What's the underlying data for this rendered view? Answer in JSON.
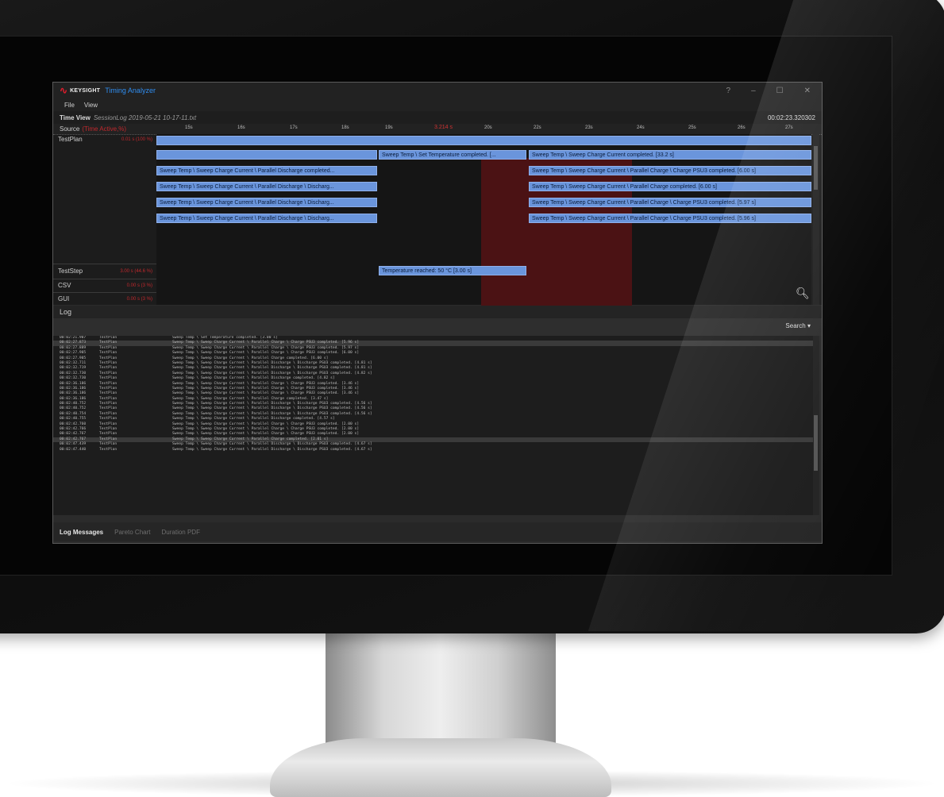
{
  "app": {
    "brand": "KEYSIGHT",
    "name": "Timing Analyzer",
    "window_controls": [
      "?",
      "–",
      "☐",
      "✕"
    ]
  },
  "menu": [
    "File",
    "View"
  ],
  "time_view": {
    "label": "Time View",
    "file": "SessionLog 2019-05-21 10-17-11.txt",
    "total": "00:02:23.320302"
  },
  "timeline": {
    "source_label": "Source",
    "source_extra": "(Time Active,%)",
    "ticks": [
      "15s",
      "16s",
      "17s",
      "18s",
      "19s",
      "20s",
      "21s",
      "22s",
      "23s",
      "24s",
      "25s",
      "26s",
      "27s"
    ],
    "cursor_label": "3.214 s",
    "rows": [
      {
        "label": "TestPlan",
        "value": "0.01 s (100 %)"
      },
      {
        "label": "TestStep",
        "value": "3.00 s (44.6 %)"
      },
      {
        "label": "CSV",
        "value": "0.00 s (3 %)"
      },
      {
        "label": "GUI",
        "value": "0.00 s (3 %)"
      }
    ],
    "bars": [
      "Sweep Temp \\ Set Temperature completed. [...",
      "Sweep Temp \\ Sweep Charge Current completed. [33.2 s]",
      "Sweep Temp \\ Sweep Charge Current \\ Parallel Discharge completed...",
      "Sweep Temp \\ Sweep Charge Current \\ Parallel Charge \\ Charge PSU3 completed. [6.00 s]",
      "Sweep Temp \\ Sweep Charge Current \\ Parallel Discharge \\ Discharg...",
      "Sweep Temp \\ Sweep Charge Current \\ Parallel Charge completed. [6.00 s]",
      "Sweep Temp \\ Sweep Charge Current \\ Parallel Discharge \\ Discharg...",
      "Sweep Temp \\ Sweep Charge Current \\ Parallel Charge \\ Charge PSU3 completed. [5.97 s]",
      "Sweep Temp \\ Sweep Charge Current \\ Parallel Discharge \\ Discharg...",
      "Sweep Temp \\ Sweep Charge Current \\ Parallel Charge \\ Charge PSU3 completed. [5.96 s]",
      "Temperature reached: 50 °C [3.00 s]"
    ]
  },
  "log": {
    "title": "Log",
    "search_label": "Search ▾",
    "entries": [
      {
        "ts": "00:02:21.907",
        "src": "TestPlan",
        "msg": "Sweep Temp \\ Set Temperature completed. [3.00 s]"
      },
      {
        "ts": "00:02:27.873",
        "src": "TestPlan",
        "msg": "Sweep Temp \\ Sweep Charge Current \\ Parallel Charge \\ Charge PSU3 completed. [5.96 s]"
      },
      {
        "ts": "00:02:27.889",
        "src": "TestPlan",
        "msg": "Sweep Temp \\ Sweep Charge Current \\ Parallel Charge \\ Charge PSU3 completed. [5.97 s]"
      },
      {
        "ts": "00:02:27.905",
        "src": "TestPlan",
        "msg": "Sweep Temp \\ Sweep Charge Current \\ Parallel Charge \\ Charge PSU3 completed. [6.00 s]"
      },
      {
        "ts": "00:02:27.905",
        "src": "TestPlan",
        "msg": "Sweep Temp \\ Sweep Charge Current \\ Parallel Charge completed. [6.00 s]"
      },
      {
        "ts": "00:02:32.711",
        "src": "TestPlan",
        "msg": "Sweep Temp \\ Sweep Charge Current \\ Parallel Discharge \\ Discharge PSU3 completed. [4.81 s]"
      },
      {
        "ts": "00:02:32.719",
        "src": "TestPlan",
        "msg": "Sweep Temp \\ Sweep Charge Current \\ Parallel Discharge \\ Discharge PSU3 completed. [4.81 s]"
      },
      {
        "ts": "00:02:32.730",
        "src": "TestPlan",
        "msg": "Sweep Temp \\ Sweep Charge Current \\ Parallel Discharge \\ Discharge PSU3 completed. [4.82 s]"
      },
      {
        "ts": "00:02:32.730",
        "src": "TestPlan",
        "msg": "Sweep Temp \\ Sweep Charge Current \\ Parallel Discharge completed. [4.82 s]"
      },
      {
        "ts": "00:02:36.186",
        "src": "TestPlan",
        "msg": "Sweep Temp \\ Sweep Charge Current \\ Parallel Charge \\ Charge PSU3 completed. [3.46 s]"
      },
      {
        "ts": "00:02:36.186",
        "src": "TestPlan",
        "msg": "Sweep Temp \\ Sweep Charge Current \\ Parallel Charge \\ Charge PSU3 completed. [3.46 s]"
      },
      {
        "ts": "00:02:36.186",
        "src": "TestPlan",
        "msg": "Sweep Temp \\ Sweep Charge Current \\ Parallel Charge \\ Charge PSU3 completed. [3.46 s]"
      },
      {
        "ts": "00:02:36.186",
        "src": "TestPlan",
        "msg": "Sweep Temp \\ Sweep Charge Current \\ Parallel Charge completed. [3.47 s]"
      },
      {
        "ts": "00:02:40.752",
        "src": "TestPlan",
        "msg": "Sweep Temp \\ Sweep Charge Current \\ Parallel Discharge \\ Discharge PSU3 completed. [4.56 s]"
      },
      {
        "ts": "00:02:40.752",
        "src": "TestPlan",
        "msg": "Sweep Temp \\ Sweep Charge Current \\ Parallel Discharge \\ Discharge PSU3 completed. [4.56 s]"
      },
      {
        "ts": "00:02:40.754",
        "src": "TestPlan",
        "msg": "Sweep Temp \\ Sweep Charge Current \\ Parallel Discharge \\ Discharge PSU3 completed. [4.56 s]"
      },
      {
        "ts": "00:02:40.755",
        "src": "TestPlan",
        "msg": "Sweep Temp \\ Sweep Charge Current \\ Parallel Discharge completed. [4.57 s]"
      },
      {
        "ts": "00:02:42.760",
        "src": "TestPlan",
        "msg": "Sweep Temp \\ Sweep Charge Current \\ Parallel Charge \\ Charge PSU3 completed. [2.00 s]"
      },
      {
        "ts": "00:02:42.766",
        "src": "TestPlan",
        "msg": "Sweep Temp \\ Sweep Charge Current \\ Parallel Charge \\ Charge PSU3 completed. [2.00 s]"
      },
      {
        "ts": "00:02:42.767",
        "src": "TestPlan",
        "msg": "Sweep Temp \\ Sweep Charge Current \\ Parallel Charge \\ Charge PSU3 completed. [2.00 s]"
      },
      {
        "ts": "00:02:42.767",
        "src": "TestPlan",
        "msg": "Sweep Temp \\ Sweep Charge Current \\ Parallel Charge completed. [2.01 s]"
      },
      {
        "ts": "00:02:47.439",
        "src": "TestPlan",
        "msg": "Sweep Temp \\ Sweep Charge Current \\ Parallel Discharge \\ Discharge PSU3 completed. [4.67 s]"
      },
      {
        "ts": "00:02:47.440",
        "src": "TestPlan",
        "msg": "Sweep Temp \\ Sweep Charge Current \\ Parallel Discharge \\ Discharge PSU3 completed. [4.67 s]"
      }
    ]
  },
  "tabs": [
    "Log Messages",
    "Pareto Chart",
    "Duration PDF"
  ]
}
